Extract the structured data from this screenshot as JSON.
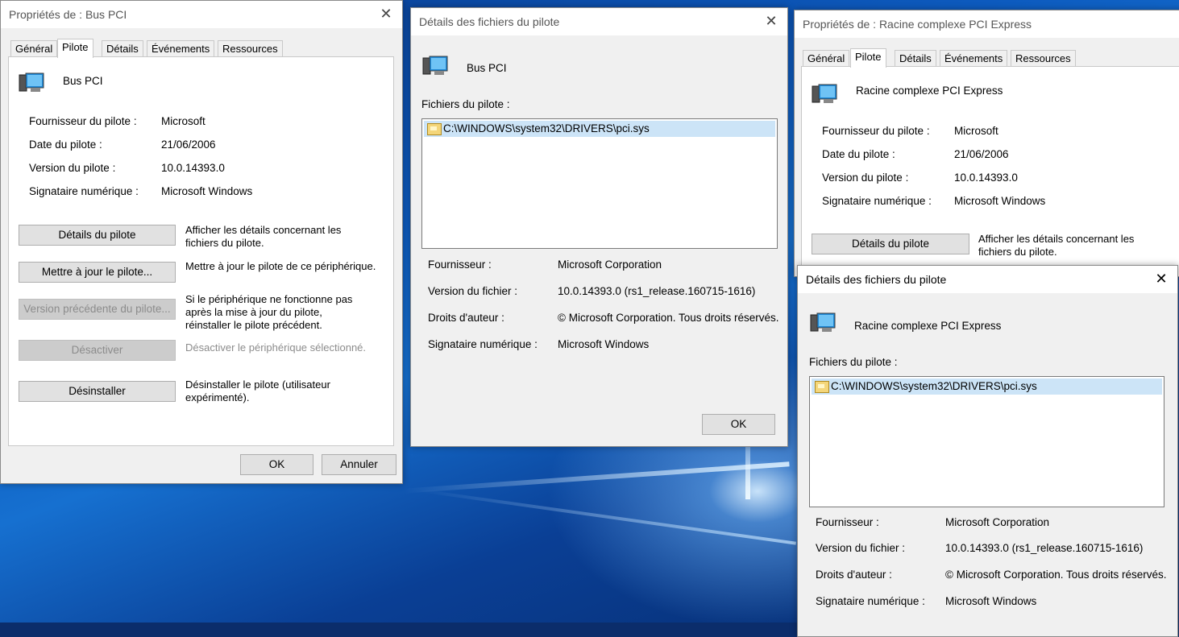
{
  "window1": {
    "title": "Propriétés de : Bus PCI",
    "tabs": [
      "Général",
      "Pilote",
      "Détails",
      "Événements",
      "Ressources"
    ],
    "device_name": "Bus PCI",
    "props": [
      {
        "label": "Fournisseur du pilote :",
        "value": "Microsoft"
      },
      {
        "label": "Date du pilote :",
        "value": "21/06/2006"
      },
      {
        "label": "Version du pilote :",
        "value": "10.0.14393.0"
      },
      {
        "label": "Signataire numérique :",
        "value": "Microsoft Windows"
      }
    ],
    "actions": [
      {
        "button": "Détails du pilote",
        "desc": "Afficher les détails concernant les fichiers du pilote."
      },
      {
        "button": "Mettre à jour le pilote...",
        "desc": "Mettre à jour le pilote de ce périphérique."
      },
      {
        "button": "Version précédente du pilote...",
        "desc": "Si le périphérique ne fonctionne pas après la mise à jour du pilote, réinstaller le pilote précédent."
      },
      {
        "button": "Désactiver",
        "desc": "Désactiver le périphérique sélectionné."
      },
      {
        "button": "Désinstaller",
        "desc": "Désinstaller le pilote (utilisateur expérimenté)."
      }
    ],
    "ok": "OK",
    "cancel": "Annuler"
  },
  "window2": {
    "title": "Détails des fichiers du pilote",
    "device_name": "Bus PCI",
    "files_label": "Fichiers du pilote :",
    "file": "C:\\WINDOWS\\system32\\DRIVERS\\pci.sys",
    "props": [
      {
        "label": "Fournisseur :",
        "value": "Microsoft Corporation"
      },
      {
        "label": "Version du fichier :",
        "value": "10.0.14393.0 (rs1_release.160715-1616)"
      },
      {
        "label": "Droits d'auteur :",
        "value": "© Microsoft Corporation. Tous droits réservés."
      },
      {
        "label": "Signataire numérique :",
        "value": "Microsoft Windows"
      }
    ],
    "ok": "OK"
  },
  "window3": {
    "title": "Propriétés de : Racine complexe PCI Express",
    "tabs": [
      "Général",
      "Pilote",
      "Détails",
      "Événements",
      "Ressources"
    ],
    "device_name": "Racine complexe PCI Express",
    "props": [
      {
        "label": "Fournisseur du pilote :",
        "value": "Microsoft"
      },
      {
        "label": "Date du pilote :",
        "value": "21/06/2006"
      },
      {
        "label": "Version du pilote :",
        "value": "10.0.14393.0"
      },
      {
        "label": "Signataire numérique :",
        "value": "Microsoft Windows"
      }
    ],
    "action": {
      "button": "Détails du pilote",
      "desc": "Afficher les détails concernant les fichiers du pilote."
    }
  },
  "window4": {
    "title": "Détails des fichiers du pilote",
    "device_name": "Racine complexe PCI Express",
    "files_label": "Fichiers du pilote :",
    "file": "C:\\WINDOWS\\system32\\DRIVERS\\pci.sys",
    "props": [
      {
        "label": "Fournisseur :",
        "value": "Microsoft Corporation"
      },
      {
        "label": "Version du fichier :",
        "value": "10.0.14393.0 (rs1_release.160715-1616)"
      },
      {
        "label": "Droits d'auteur :",
        "value": "© Microsoft Corporation. Tous droits réservés."
      },
      {
        "label": "Signataire numérique :",
        "value": "Microsoft Windows"
      }
    ]
  },
  "close_glyph": "✕"
}
